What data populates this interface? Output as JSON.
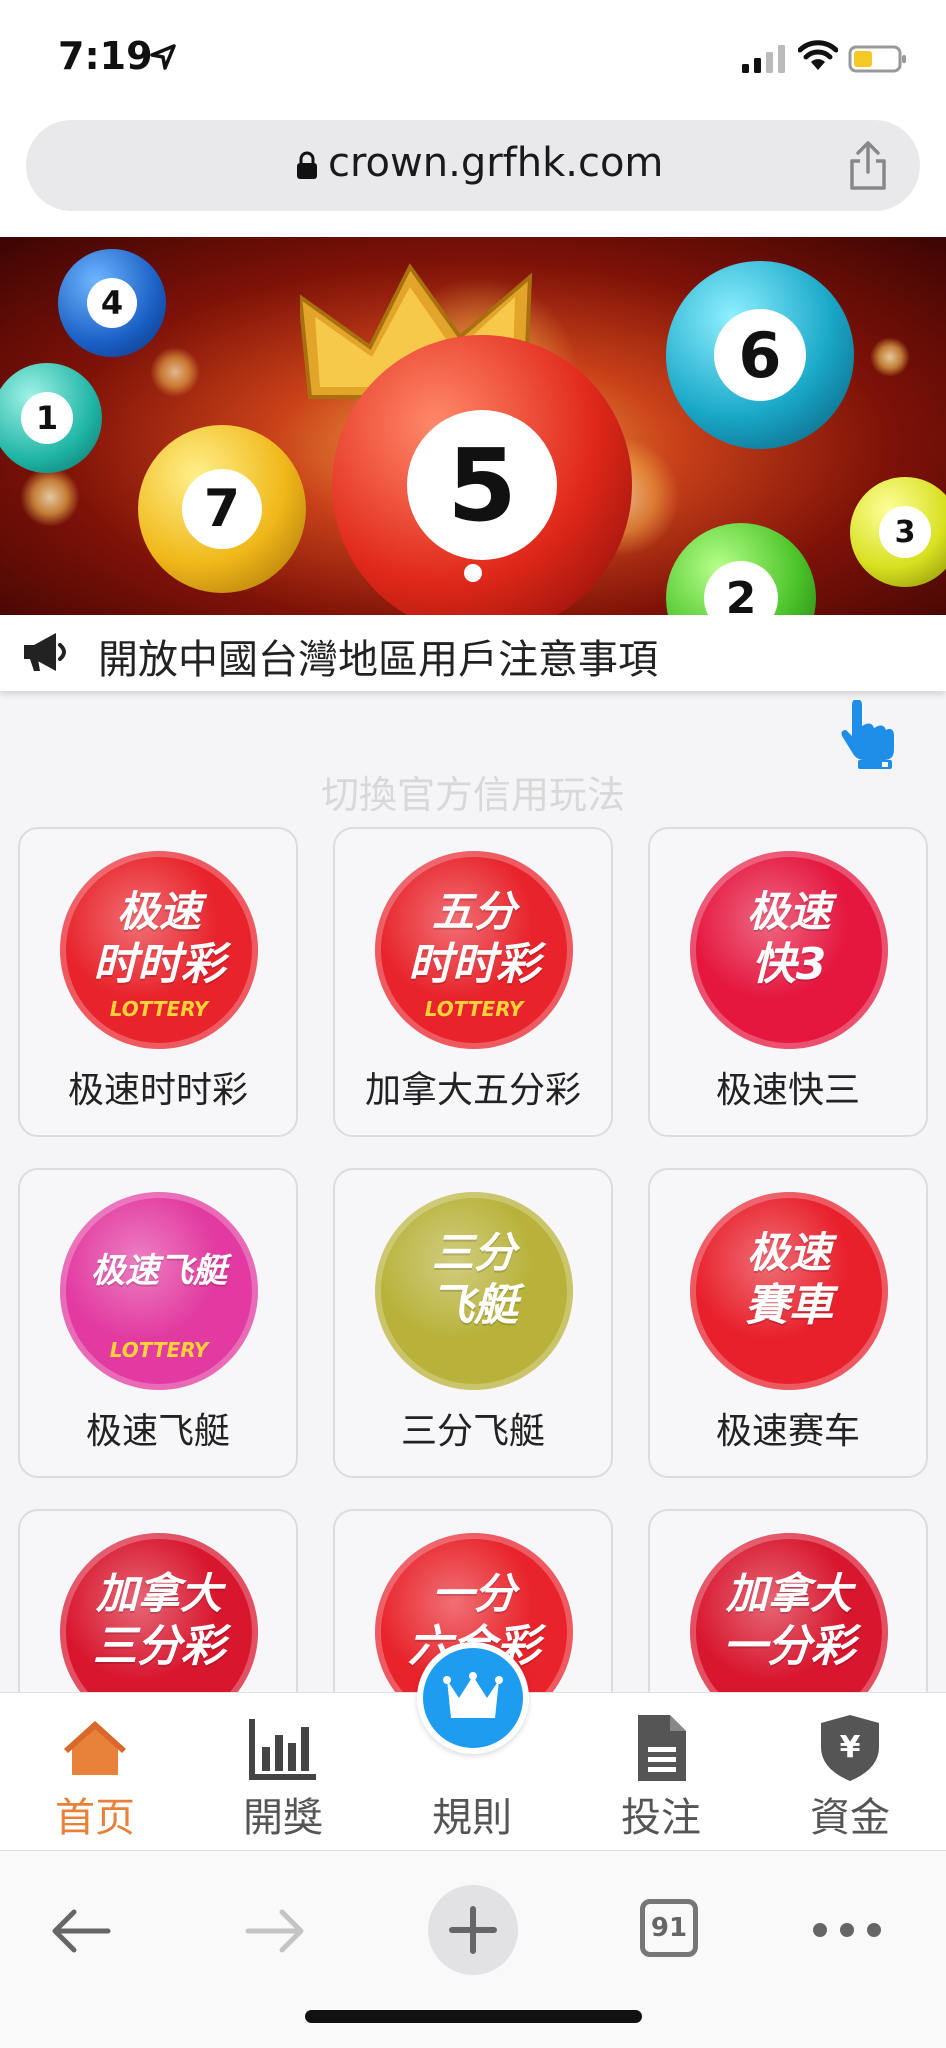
{
  "status_bar": {
    "time": "7:19"
  },
  "browser": {
    "url": "crown.grfhk.com",
    "tab_count": "91"
  },
  "notice": {
    "text": "開放中國台灣地區用戶注意事項"
  },
  "switch_mode": {
    "text": "切換官方信用玩法"
  },
  "games": [
    {
      "name": "极速时时彩",
      "logo_line1": "极速",
      "logo_line2": "时时彩",
      "logo_sub": "LOTTERY",
      "color": "#e8232b"
    },
    {
      "name": "加拿大五分彩",
      "logo_line1": "五分",
      "logo_line2": "时时彩",
      "logo_sub": "LOTTERY",
      "color": "#e8232b"
    },
    {
      "name": "极速快三",
      "logo_line1": "极速",
      "logo_line2": "快3",
      "logo_sub": "",
      "color": "#e5173f"
    },
    {
      "name": "极速飞艇",
      "logo_line1": "极速飞艇",
      "logo_line2": "",
      "logo_sub": "LOTTERY",
      "color": "#e23aa0"
    },
    {
      "name": "三分飞艇",
      "logo_line1": "三分",
      "logo_line2": "飞艇",
      "logo_sub": "",
      "color": "#b8b23a"
    },
    {
      "name": "极速赛车",
      "logo_line1": "极速",
      "logo_line2": "賽車",
      "logo_sub": "",
      "color": "#e8202c"
    },
    {
      "name": "加拿大三分彩",
      "logo_line1": "加拿大",
      "logo_line2": "三分彩",
      "logo_sub": "",
      "color": "#d8162e"
    },
    {
      "name": "一分六合彩",
      "logo_line1": "一分",
      "logo_line2": "六合彩",
      "logo_sub": "",
      "color": "#e8232b"
    },
    {
      "name": "加拿大一分彩",
      "logo_line1": "加拿大",
      "logo_line2": "一分彩",
      "logo_sub": "",
      "color": "#d8162e"
    }
  ],
  "tabbar": {
    "home": "首页",
    "results": "開獎",
    "rules": "規則",
    "bets": "投注",
    "funds": "資金",
    "active_color": "#e8813a",
    "accent_color": "#1e9df0"
  },
  "banner": {
    "balls": [
      "4",
      "1",
      "7",
      "5",
      "6",
      "3",
      "2"
    ]
  }
}
